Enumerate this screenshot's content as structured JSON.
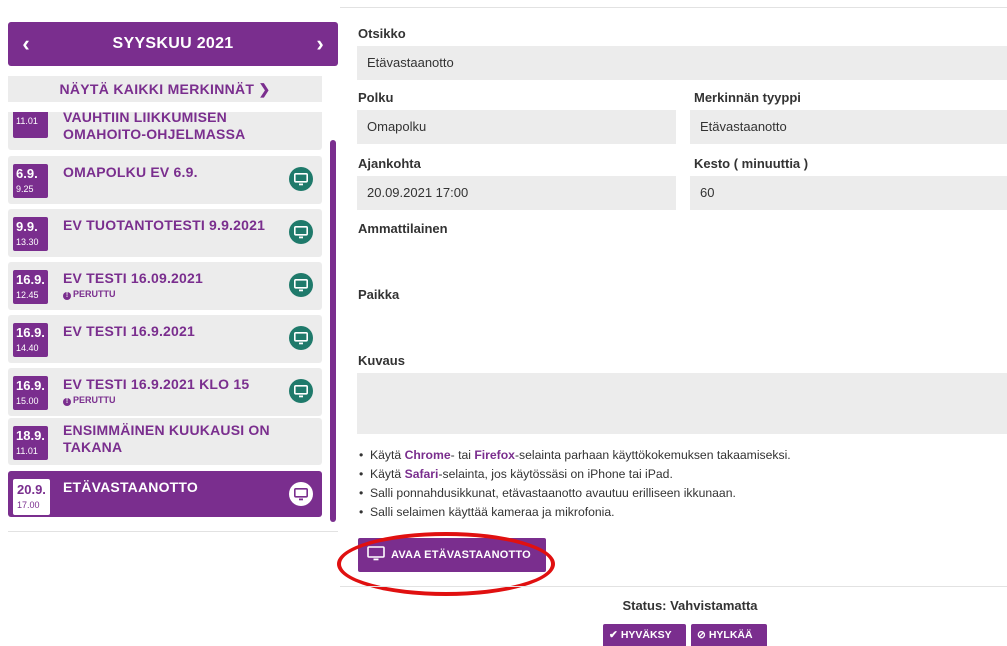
{
  "calendar": {
    "month": "SYYSKUU 2021",
    "prev_icon": "chevron-left-icon",
    "next_icon": "chevron-right-icon",
    "show_all": "NÄYTÄ KAIKKI MERKINNÄT ❯",
    "entries": [
      {
        "date": "",
        "time": "11.01",
        "title": "VAUHTIIN LIIKKUMISEN OMAHOITO-OHJELMASSA",
        "status": "",
        "icon": ""
      },
      {
        "date": "6.9.",
        "time": "9.25",
        "title": "OMAPOLKU EV 6.9.",
        "status": "",
        "icon": "monitor-icon"
      },
      {
        "date": "9.9.",
        "time": "13.30",
        "title": "EV TUOTANTOTESTI 9.9.2021",
        "status": "",
        "icon": "monitor-icon"
      },
      {
        "date": "16.9.",
        "time": "12.45",
        "title": "EV TESTI 16.09.2021",
        "status": "PERUTTU",
        "icon": "monitor-icon"
      },
      {
        "date": "16.9.",
        "time": "14.40",
        "title": "EV TESTI 16.9.2021",
        "status": "",
        "icon": "monitor-icon"
      },
      {
        "date": "16.9.",
        "time": "15.00",
        "title": "EV TESTI 16.9.2021 KLO 15",
        "status": "PERUTTU",
        "icon": "monitor-icon"
      },
      {
        "date": "18.9.",
        "time": "11.01",
        "title": "ENSIMMÄINEN KUUKAUSI ON TAKANA",
        "status": "",
        "icon": ""
      },
      {
        "date": "20.9.",
        "time": "17.00",
        "title": "ETÄVASTAANOTTO",
        "status": "",
        "icon": "monitor-icon",
        "active": true
      }
    ]
  },
  "form": {
    "otsikko_label": "Otsikko",
    "otsikko_value": "Etävastaanotto",
    "polku_label": "Polku",
    "polku_value": "Omapolku",
    "tyyppi_label": "Merkinnän tyyppi",
    "tyyppi_value": "Etävastaanotto",
    "ajankohta_label": "Ajankohta",
    "ajankohta_value": "20.09.2021 17:00",
    "kesto_label": "Kesto ( minuuttia )",
    "kesto_value": "60",
    "ammattilainen_label": "Ammattilainen",
    "ammattilainen_value": "",
    "paikka_label": "Paikka",
    "paikka_value": "",
    "kuvaus_label": "Kuvaus",
    "kuvaus_value": ""
  },
  "instructions": {
    "line1_pre": "Käytä ",
    "line1_chrome": "Chrome",
    "line1_mid": "- tai ",
    "line1_firefox": "Firefox",
    "line1_post": "-selainta parhaan käyttökokemuksen takaamiseksi.",
    "line2_pre": "Käytä ",
    "line2_safari": "Safari",
    "line2_post": "-selainta, jos käytössäsi on iPhone tai iPad.",
    "line3": "Salli ponnahdusikkunat, etävastaanotto avautuu erilliseen ikkunaan.",
    "line4": "Salli selaimen käyttää kameraa ja mikrofonia."
  },
  "actions": {
    "open_label": "AVAA ETÄVASTAANOTTO",
    "status": "Status: Vahvistamatta",
    "accept_label": "HYVÄKSY",
    "reject_label": "HYLKÄÄ"
  },
  "colors": {
    "brand_purple": "#7a2e8e",
    "icon_teal": "#1f7a6b",
    "highlight_red": "#e01010"
  }
}
